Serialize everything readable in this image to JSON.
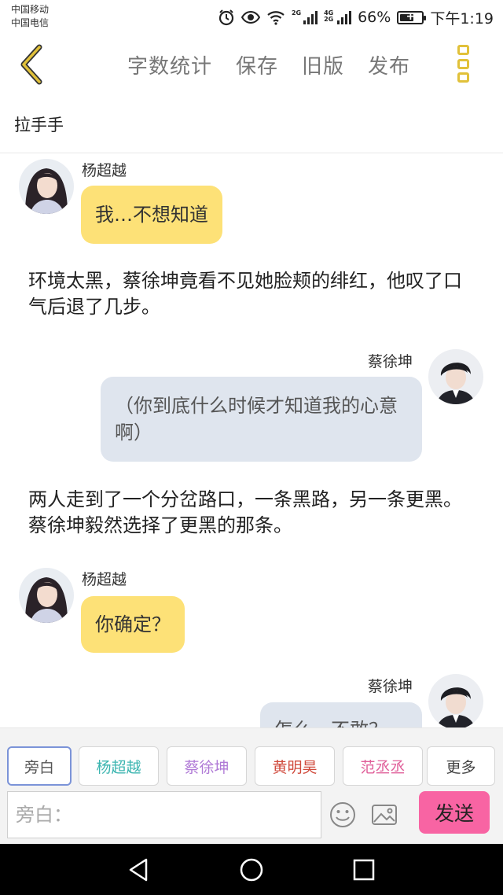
{
  "status_bar": {
    "carrier_1": "中国移动",
    "carrier_2": "中国电信",
    "signal_1_label": "2G",
    "signal_2_label": "4G 2G",
    "battery_percent": "66%",
    "battery_level": 0.66,
    "time": "下午1:19"
  },
  "toolbar": {
    "back_icon": "chevron-left-icon",
    "actions": [
      "字数统计",
      "保存",
      "旧版",
      "发布"
    ],
    "more_icon": "more-vertical-icon",
    "accent_color": "#e1c13a"
  },
  "story": {
    "title": "拉手手"
  },
  "messages": [
    {
      "type": "left",
      "speaker": "杨超越",
      "text": "我…不想知道"
    },
    {
      "type": "narration",
      "text": "环境太黑，蔡徐坤竟看不见她脸颊的绯红，他叹了口气后退了几步。"
    },
    {
      "type": "right",
      "speaker": "蔡徐坤",
      "text": "（你到底什么时候才知道我的心意啊）"
    },
    {
      "type": "narration",
      "text": "两人走到了一个分岔路口，一条黑路，另一条更黑。蔡徐坤毅然选择了更黑的那条。"
    },
    {
      "type": "left",
      "speaker": "杨超越",
      "text": "你确定？"
    },
    {
      "type": "right",
      "speaker": "蔡徐坤",
      "text": "怎么，不敢？"
    }
  ],
  "roles": [
    {
      "label": "旁白",
      "color": "#555555"
    },
    {
      "label": "杨超越",
      "color": "#3bb5b0"
    },
    {
      "label": "蔡徐坤",
      "color": "#b07ad6"
    },
    {
      "label": "黄明昊",
      "color": "#d04a3c"
    },
    {
      "label": "范丞丞",
      "color": "#e0609a"
    },
    {
      "label": "更多",
      "color": "#444444"
    }
  ],
  "input": {
    "placeholder": "旁白："
  },
  "send_label": "发送",
  "colors": {
    "left_bubble": "#fde177",
    "right_bubble": "#dfe5ee",
    "send_button": "#f864a3"
  }
}
